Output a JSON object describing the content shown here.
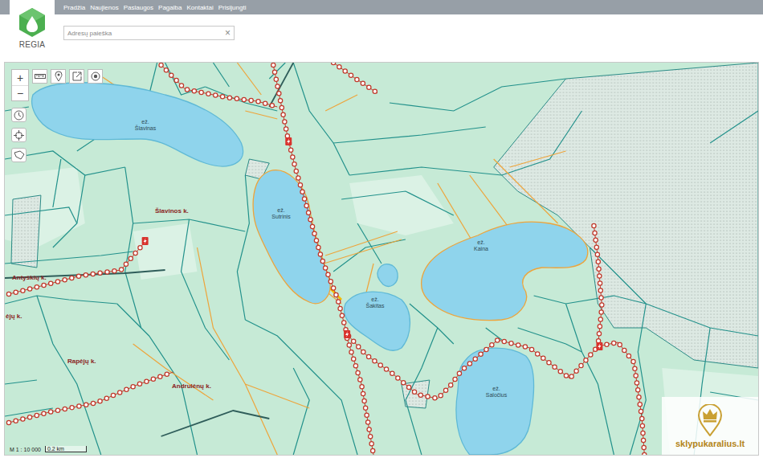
{
  "header": {
    "logo": "REGIA",
    "nav": [
      {
        "label": "Pradžia"
      },
      {
        "label": "Naujienos"
      },
      {
        "label": "Paslaugos"
      },
      {
        "label": "Pagalba"
      },
      {
        "label": "Kontaktai"
      },
      {
        "label": "Prisijungti"
      }
    ],
    "search": {
      "placeholder": "Adresų paieška",
      "clear": "×"
    }
  },
  "map": {
    "zoom": {
      "in": "+",
      "out": "−"
    },
    "labels": [
      {
        "kind": "lake",
        "prefix": "ež.",
        "name": "Šlavinas"
      },
      {
        "kind": "lake",
        "prefix": "ež.",
        "name": "Sutrinis"
      },
      {
        "kind": "lake",
        "prefix": "ež.",
        "name": "Šakitas"
      },
      {
        "kind": "lake",
        "prefix": "ež.",
        "name": "Kaina"
      },
      {
        "kind": "lake",
        "prefix": "ež.",
        "name": "Saločius"
      },
      {
        "kind": "village",
        "name": "Šlavinos k."
      },
      {
        "kind": "village",
        "name": "Antyškių k."
      },
      {
        "kind": "village",
        "name": "ėjų k."
      },
      {
        "kind": "village",
        "name": "Rapėjų k."
      },
      {
        "kind": "village",
        "name": "Andrulėnų k."
      }
    ],
    "scale": {
      "ratio": "M 1 : 10 000",
      "distance": "0.2 km"
    },
    "watermark": "sklypukaralius.lt"
  }
}
